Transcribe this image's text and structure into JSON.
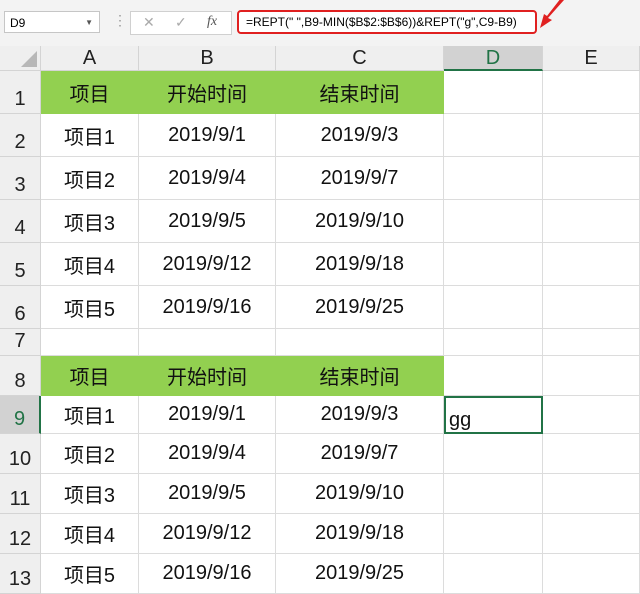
{
  "name_box": "D9",
  "formula": "=REPT(\" \",B9-MIN($B$2:$B$6))&REPT(\"g\",C9-B9)",
  "columns": [
    "A",
    "B",
    "C",
    "D",
    "E"
  ],
  "selected_column": "D",
  "selected_row": "9",
  "active_cell": "D9",
  "accent_green": "#92D050",
  "rows": [
    {
      "n": "1",
      "cells": [
        "项目",
        "开始时间",
        "结束时间",
        "",
        ""
      ],
      "header": true
    },
    {
      "n": "2",
      "cells": [
        "项目1",
        "2019/9/1",
        "2019/9/3",
        "",
        ""
      ]
    },
    {
      "n": "3",
      "cells": [
        "项目2",
        "2019/9/4",
        "2019/9/7",
        "",
        ""
      ]
    },
    {
      "n": "4",
      "cells": [
        "项目3",
        "2019/9/5",
        "2019/9/10",
        "",
        ""
      ]
    },
    {
      "n": "5",
      "cells": [
        "项目4",
        "2019/9/12",
        "2019/9/18",
        "",
        ""
      ]
    },
    {
      "n": "6",
      "cells": [
        "项目5",
        "2019/9/16",
        "2019/9/25",
        "",
        ""
      ]
    },
    {
      "n": "7",
      "cells": [
        "",
        "",
        "",
        "",
        ""
      ]
    },
    {
      "n": "8",
      "cells": [
        "项目",
        "开始时间",
        "结束时间",
        "",
        ""
      ],
      "header": true
    },
    {
      "n": "9",
      "cells": [
        "项目1",
        "2019/9/1",
        "2019/9/3",
        "gg",
        ""
      ]
    },
    {
      "n": "10",
      "cells": [
        "项目2",
        "2019/9/4",
        "2019/9/7",
        "",
        ""
      ]
    },
    {
      "n": "11",
      "cells": [
        "项目3",
        "2019/9/5",
        "2019/9/10",
        "",
        ""
      ]
    },
    {
      "n": "12",
      "cells": [
        "项目4",
        "2019/9/12",
        "2019/9/18",
        "",
        ""
      ]
    },
    {
      "n": "13",
      "cells": [
        "项目5",
        "2019/9/16",
        "2019/9/25",
        "",
        ""
      ]
    }
  ]
}
